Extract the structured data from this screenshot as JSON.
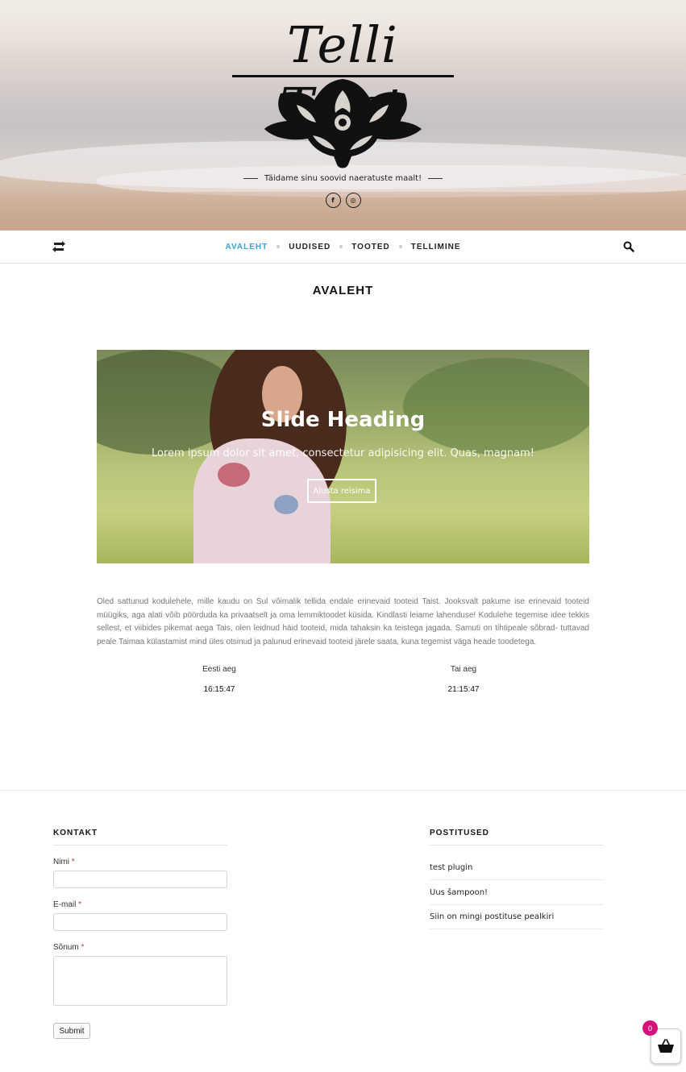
{
  "header": {
    "logo_text": "Telli Taist",
    "tagline": "Täidame sinu soovid naeratuste maalt!",
    "social": [
      {
        "name": "facebook",
        "glyph": "f"
      },
      {
        "name": "instagram",
        "glyph": "◎"
      }
    ]
  },
  "nav": {
    "items": [
      {
        "label": "AVALEHT",
        "active": true
      },
      {
        "label": "UUDISED",
        "active": false
      },
      {
        "label": "TOOTED",
        "active": false
      },
      {
        "label": "TELLIMINE",
        "active": false
      }
    ],
    "active_color": "#36a5dc"
  },
  "page": {
    "title": "AVALEHT"
  },
  "slider": {
    "heading": "Slide Heading",
    "text": "Lorem ipsum dolor sit amet, consectetur adipisicing elit. Quas, magnam!",
    "button": "Alusta reisima"
  },
  "intro": "Oled sattunud kodulehele, mille kaudu on Sul võimalik tellida endale erinevaid tooteid Taist. Jooksvalt pakume ise erinevaid tooteid müügiks, aga alati võib pöörduda ka privaatselt ja oma lemmiktoodet küsida. Kindlasti leiame lahenduse! Kodulehe tegemise idee tekkis sellest, et viibides pikemat aega Tais, olen leidnud häid tooteid, mida tahaksin ka teistega jagada. Samuti on tihtipeale sõbrad- tuttavad peale Taimaa külastamist mind üles otsinud ja palunud erinevaid tooteid järele saata, kuna tegemist väga heade toodetega.",
  "clocks": [
    {
      "label": "Eesti aeg",
      "time": "16:15:47"
    },
    {
      "label": "Tai aeg",
      "time": "21:15:47"
    }
  ],
  "footer": {
    "contact": {
      "title": "KONTAKT",
      "name_label": "Nimi",
      "email_label": "E-mail",
      "message_label": "Sõnum",
      "required_mark": "*",
      "submit": "Submit"
    },
    "posts": {
      "title": "POSTITUSED",
      "items": [
        "test plugin",
        "Uus šampoon!",
        "Siin on mingi postituse pealkiri"
      ]
    }
  },
  "cart": {
    "count": "0",
    "badge_color": "#d6127a"
  }
}
